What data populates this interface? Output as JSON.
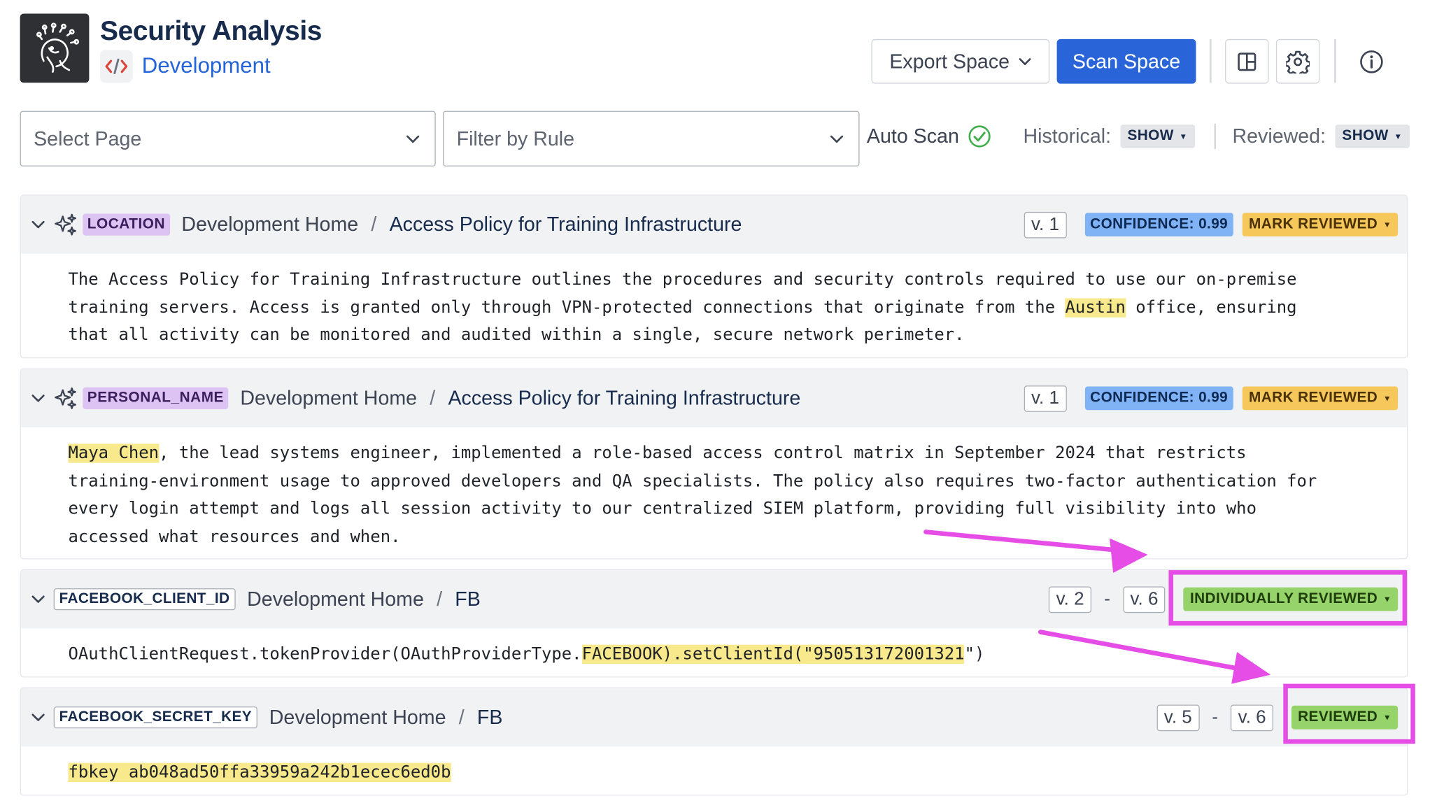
{
  "header": {
    "title": "Security Analysis",
    "space_name": "Development",
    "export_label": "Export Space",
    "scan_label": "Scan Space"
  },
  "filters": {
    "page_placeholder": "Select Page",
    "rule_placeholder": "Filter by Rule",
    "auto_scan_label": "Auto Scan",
    "historical_label": "Historical:",
    "historical_value": "SHOW",
    "reviewed_label": "Reviewed:",
    "reviewed_value": "SHOW"
  },
  "findings": [
    {
      "rule": "LOCATION",
      "page_parent": "Development Home",
      "page_title": "Access Policy for Training Infrastructure",
      "version": "v. 1",
      "confidence": "CONFIDENCE: 0.99",
      "status": "MARK REVIEWED",
      "body_lines": [
        [
          "The Access Policy for Training Infrastructure outlines the procedures and security controls required to use our on-premise"
        ],
        [
          "training servers. Access is granted only through VPN-protected connections that originate from the ",
          "Austin",
          " office, ensuring"
        ],
        [
          "that all activity can be monitored and audited within a single, secure network perimeter."
        ]
      ]
    },
    {
      "rule": "PERSONAL_NAME",
      "page_parent": "Development Home",
      "page_title": "Access Policy for Training Infrastructure",
      "version": "v. 1",
      "confidence": "CONFIDENCE: 0.99",
      "status": "MARK REVIEWED",
      "body_lines": [
        [
          "",
          "Maya Chen",
          ", the lead systems engineer, implemented a role-based access control matrix in September 2024 that restricts"
        ],
        [
          "training-environment usage to approved developers and QA specialists. The policy also requires two-factor authentication for"
        ],
        [
          "every login attempt and logs all session activity to our centralized SIEM platform, providing full visibility into who"
        ],
        [
          "accessed what resources and when."
        ]
      ]
    },
    {
      "rule": "FACEBOOK_CLIENT_ID",
      "page_parent": "Development Home",
      "page_title": "FB",
      "version_from": "v. 2",
      "version_to": "v. 6",
      "status": "INDIVIDUALLY REVIEWED",
      "body_lines": [
        [
          "OAuthClientRequest.tokenProvider(OAuthProviderType.",
          "FACEBOOK).setClientId(\"950513172001321",
          "\")"
        ]
      ]
    },
    {
      "rule": "FACEBOOK_SECRET_KEY",
      "page_parent": "Development Home",
      "page_title": "FB",
      "version_from": "v. 5",
      "version_to": "v. 6",
      "status": "REVIEWED",
      "body_lines": [
        [
          "",
          "fbkey ab048ad50ffa33959a242b1ecec6ed0b"
        ]
      ]
    }
  ],
  "colors": {
    "primary": "#2965d8",
    "annotation": "#e64ce6",
    "highlight": "#f8e98c",
    "confidence": "#7fb3f5",
    "mark_reviewed": "#f6c85c",
    "reviewed": "#96d36b",
    "rule_tag": "#dcc3f3"
  },
  "icons": {
    "logo": "medusa-logo",
    "space": "code-icon",
    "export_caret": "chevron-down-icon",
    "layout": "layout-panels-icon",
    "settings": "gear-icon",
    "info": "info-icon",
    "auto_scan_status": "check-circle-icon",
    "ai_detected": "sparkles-icon"
  }
}
